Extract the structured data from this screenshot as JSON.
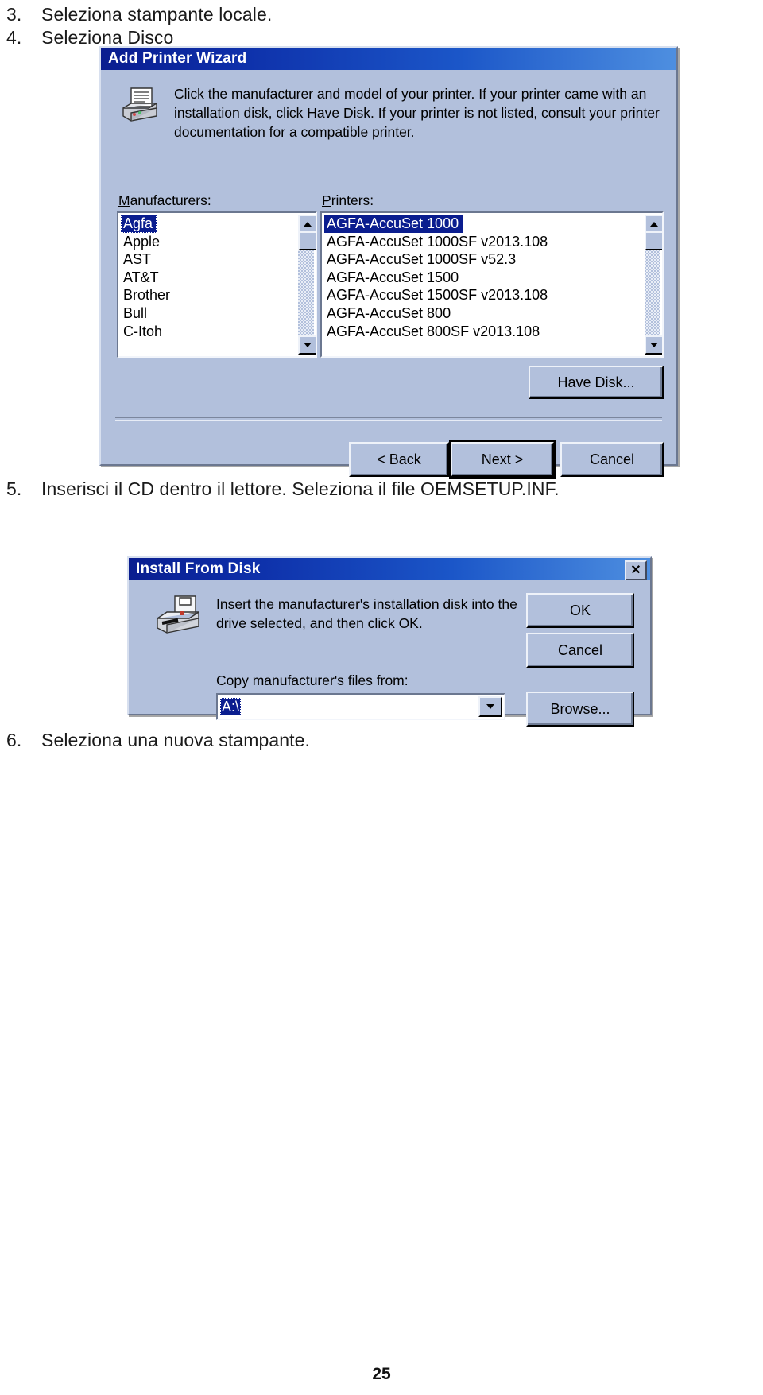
{
  "document": {
    "steps": [
      {
        "num": "3.",
        "text": "Seleziona stampante locale."
      },
      {
        "num": "4.",
        "text": "Seleziona Disco"
      },
      {
        "num": "5.",
        "text": "Inserisci il CD dentro il lettore. Seleziona il file  OEMSETUP.INF."
      },
      {
        "num": "6.",
        "text": "Seleziona una nuova stampante."
      }
    ],
    "page_number": "25"
  },
  "wizard": {
    "title": "Add Printer Wizard",
    "icon": "printer-icon",
    "instruction": "Click the manufacturer and model of your printer. If your printer came with an installation disk, click Have Disk. If your printer is not listed, consult your printer documentation for a compatible printer.",
    "manufacturers_label": "Manufacturers:",
    "manufacturers": [
      "Agfa",
      "Apple",
      "AST",
      "AT&T",
      "Brother",
      "Bull",
      "C-Itoh"
    ],
    "manufacturers_selected": "Agfa",
    "printers_label": "Printers:",
    "printers": [
      "AGFA-AccuSet 1000",
      "AGFA-AccuSet 1000SF v2013.108",
      "AGFA-AccuSet 1000SF v52.3",
      "AGFA-AccuSet 1500",
      "AGFA-AccuSet 1500SF v2013.108",
      "AGFA-AccuSet 800",
      "AGFA-AccuSet 800SF v2013.108"
    ],
    "printers_selected": "AGFA-AccuSet 1000",
    "buttons": {
      "have_disk": "Have Disk...",
      "back": "< Back",
      "next": "Next >",
      "cancel": "Cancel"
    }
  },
  "install_from_disk": {
    "title": "Install From Disk",
    "close_glyph": "✕",
    "icon": "floppy-drive-icon",
    "message": "Insert the manufacturer's installation disk into the drive selected, and then click OK.",
    "copy_label": "Copy manufacturer's files from:",
    "path_value": "A:\\",
    "buttons": {
      "ok": "OK",
      "cancel": "Cancel",
      "browse": "Browse..."
    }
  },
  "colors": {
    "dialog_face": "#b2c0dc",
    "title_start": "#0a1d8f",
    "title_end": "#4e8fe0",
    "selection": "#0a1d8f",
    "text": "#000000"
  }
}
